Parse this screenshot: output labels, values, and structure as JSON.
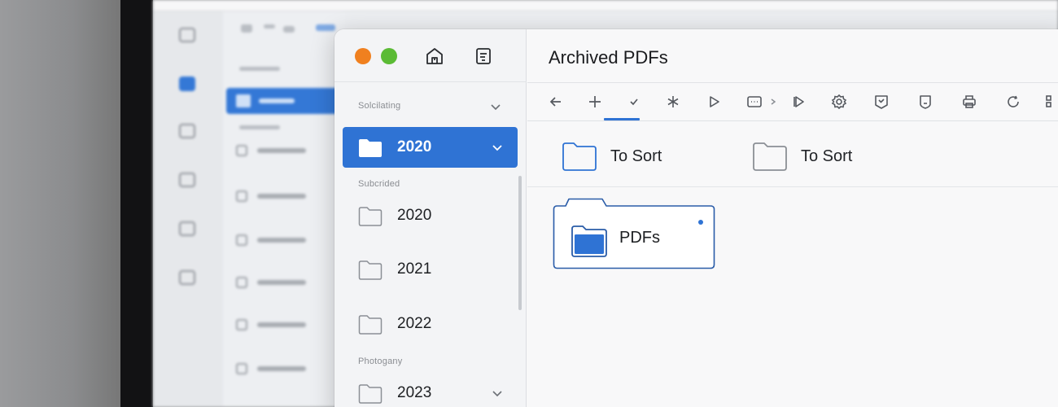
{
  "window": {
    "title": "Archived PDFs"
  },
  "colors": {
    "accent": "#2f73d4",
    "traffic_orange": "#f0801f",
    "traffic_green": "#5bbb35"
  },
  "sidebar": {
    "header_icons": [
      "home-icon",
      "notes-icon"
    ],
    "sections": [
      {
        "label": "Solcilating"
      },
      {
        "label": "Subcrided"
      },
      {
        "label": "Photogany"
      }
    ],
    "items": [
      {
        "label": "2020",
        "selected": true
      },
      {
        "label": "2020"
      },
      {
        "label": "2021"
      },
      {
        "label": "2022"
      },
      {
        "label": "2023"
      }
    ]
  },
  "toolbar": {
    "icons": [
      "back-arrow-icon",
      "plus-icon",
      "check-icon",
      "asterisk-icon",
      "play-icon",
      "media-icon",
      "chevron-right-icon",
      "play-outline-icon",
      "settings-icon",
      "badge-icon",
      "shield-icon",
      "print-icon",
      "refresh-icon",
      "grid-icon"
    ]
  },
  "quick_folders": [
    {
      "label": "To Sort",
      "accent": true
    },
    {
      "label": "To Sort",
      "accent": false
    }
  ],
  "content": {
    "folders": [
      {
        "label": "PDFs"
      }
    ]
  }
}
